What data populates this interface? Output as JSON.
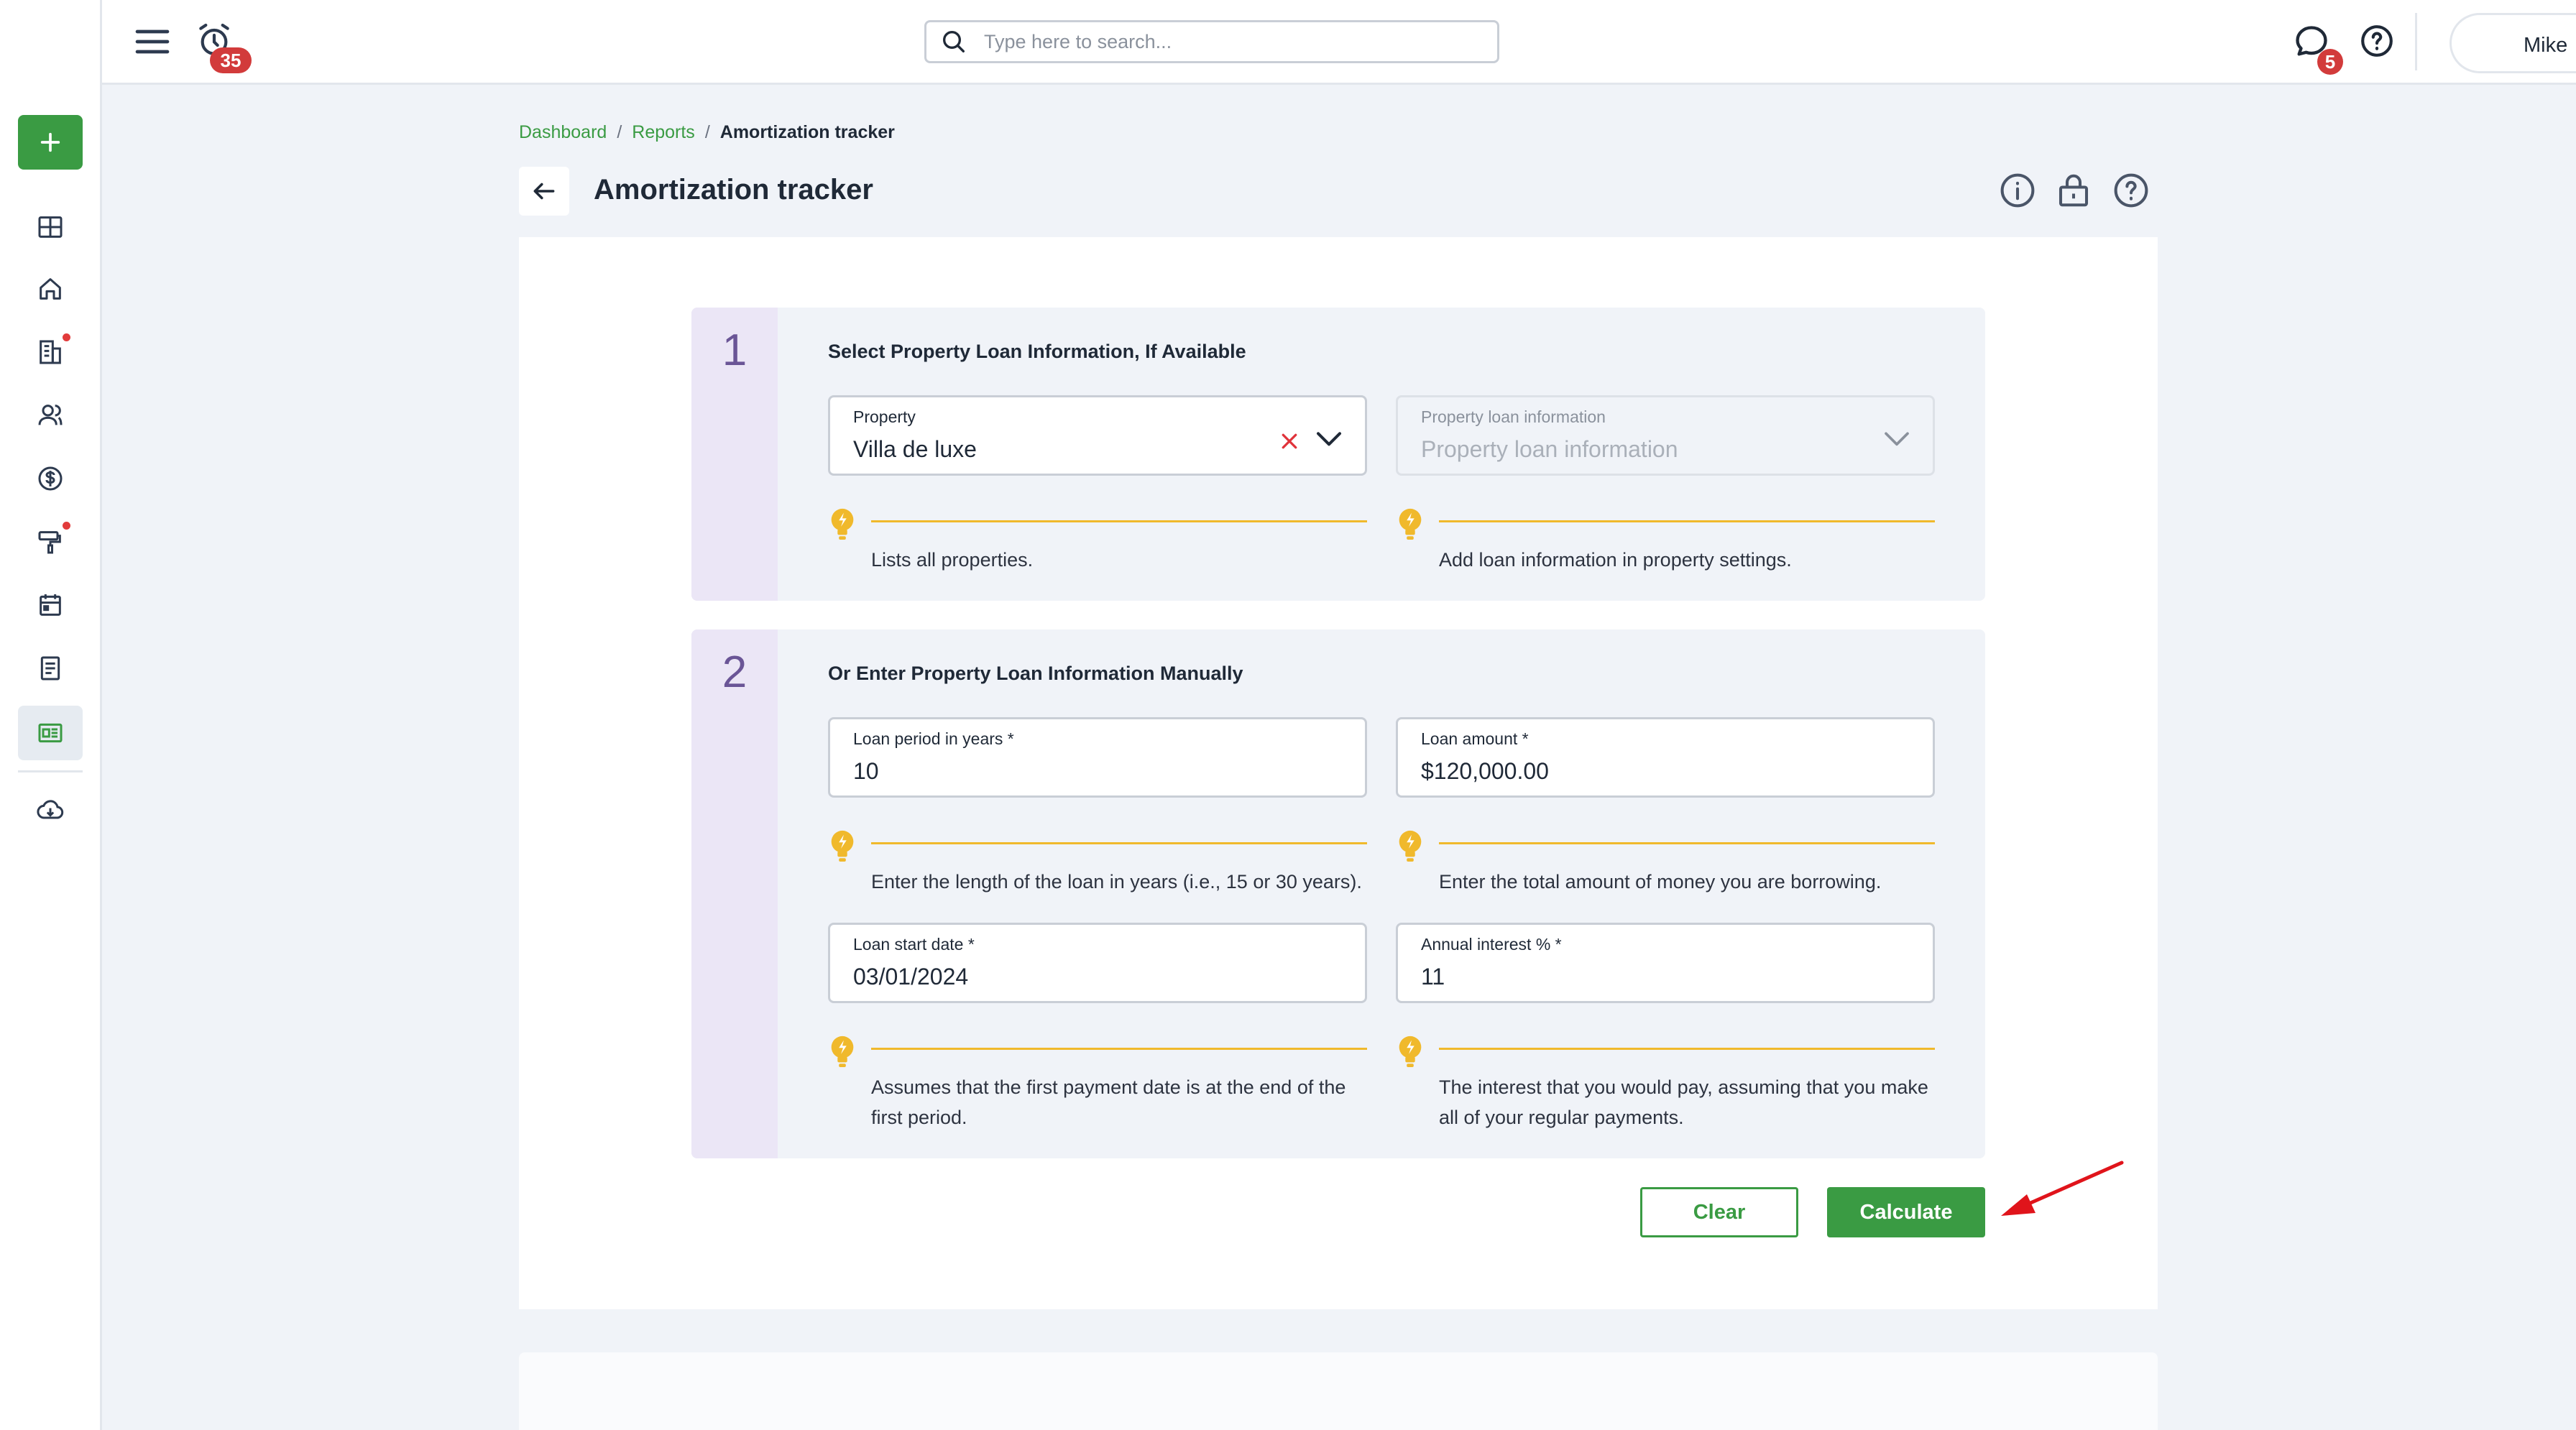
{
  "sidebar": {
    "add_icon": "plus-icon",
    "items": [
      {
        "name": "dashboard",
        "icon": "grid-icon"
      },
      {
        "name": "properties",
        "icon": "home-icon"
      },
      {
        "name": "leasing",
        "icon": "building-doc-icon",
        "has_dot": true
      },
      {
        "name": "people",
        "icon": "users-icon"
      },
      {
        "name": "accounting",
        "icon": "dollar-icon"
      },
      {
        "name": "maintenance",
        "icon": "paint-roller-icon",
        "has_dot": true
      },
      {
        "name": "calendar",
        "icon": "calendar-icon"
      },
      {
        "name": "documents",
        "icon": "document-icon"
      },
      {
        "name": "reports",
        "icon": "report-icon",
        "active": true
      },
      {
        "name": "downloads",
        "icon": "cloud-download-icon"
      }
    ]
  },
  "topbar": {
    "alarm_badge": "35",
    "search_placeholder": "Type here to search...",
    "chat_badge": "5",
    "user_name": "Mike"
  },
  "breadcrumb": {
    "items": [
      "Dashboard",
      "Reports"
    ],
    "separator": "/",
    "current": "Amortization tracker"
  },
  "page": {
    "title": "Amortization tracker"
  },
  "section1": {
    "number": "1",
    "title": "Select Property Loan Information, If Available",
    "property": {
      "label": "Property",
      "value": "Villa de luxe"
    },
    "loan_info": {
      "label": "Property loan information",
      "placeholder": "Property loan information"
    },
    "hint_property": "Lists all properties.",
    "hint_loan_info": "Add loan information in property settings."
  },
  "section2": {
    "number": "2",
    "title": "Or Enter Property Loan Information Manually",
    "loan_period": {
      "label": "Loan period in years *",
      "value": "10",
      "hint": "Enter the length of the loan in years (i.e., 15 or 30 years)."
    },
    "loan_amount": {
      "label": "Loan amount *",
      "value": "$120,000.00",
      "hint": "Enter the total amount of money you are borrowing."
    },
    "start_date": {
      "label": "Loan start date *",
      "value": "03/01/2024",
      "hint": "Assumes that the first payment date is at the end of the first period."
    },
    "interest": {
      "label": "Annual interest % *",
      "value": "11",
      "hint": "The interest that you would pay, assuming that you make all of your regular payments."
    }
  },
  "actions": {
    "clear_label": "Clear",
    "calculate_label": "Calculate"
  },
  "colors": {
    "accent": "#3a9b43",
    "badge": "#d23b3b",
    "hint": "#f0b92c",
    "section_number": "#6a5596",
    "annotation_arrow": "#e0141b"
  }
}
